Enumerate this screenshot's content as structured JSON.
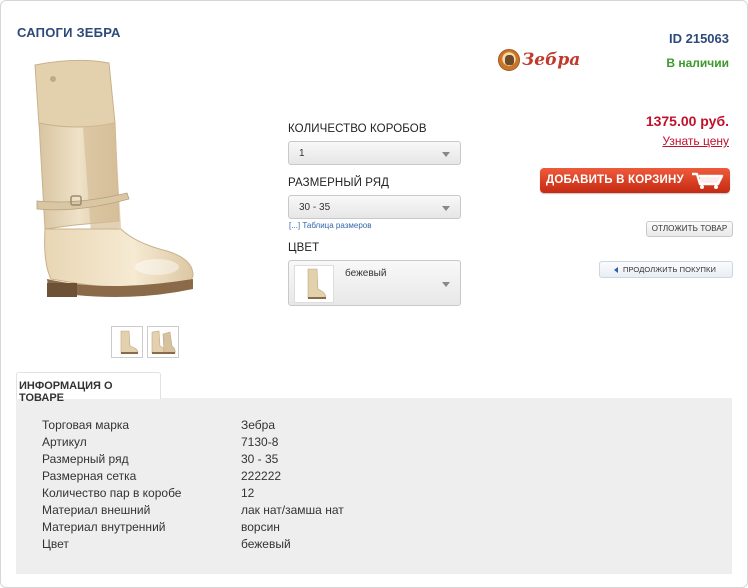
{
  "product": {
    "title": "САПОГИ ЗЕБРА",
    "id_text": "ID 215063",
    "stock_status": "В наличии",
    "brand_logo_text": "Зебра",
    "main_image_icon": "boot-image",
    "thumbnail_icons": [
      "boot-thumbnail-side",
      "boot-thumbnail-pair"
    ]
  },
  "options": {
    "box_count_label": "КОЛИЧЕСТВО КОРОБОВ",
    "box_count_value": "1",
    "size_range_label": "РАЗМЕРНЫЙ РЯД",
    "size_range_value": "30 - 35",
    "size_table_link": "[...] Таблица размеров",
    "color_label": "ЦВЕТ",
    "color_value": "бежевый"
  },
  "purchase": {
    "price": "1375.00 руб.",
    "price_link": "Узнать цену",
    "add_to_cart": "ДОБАВИТЬ В КОРЗИНУ",
    "defer": "ОТЛОЖИТЬ ТОВАР",
    "continue": "ПРОДОЛЖИТЬ ПОКУПКИ"
  },
  "info": {
    "tab_label": "ИНФОРМАЦИЯ О ТОВАРЕ",
    "rows": [
      {
        "label": "Торговая марка",
        "value": "Зебра"
      },
      {
        "label": "Артикул",
        "value": "7130-8"
      },
      {
        "label": "Размерный ряд",
        "value": "30 - 35"
      },
      {
        "label": "Размерная сетка",
        "value": "222222"
      },
      {
        "label": "Количество пар в коробе",
        "value": "12"
      },
      {
        "label": "Материал внешний",
        "value": "лак нат/замша нат"
      },
      {
        "label": "Материал внутренний",
        "value": "ворсин"
      },
      {
        "label": "Цвет",
        "value": "бежевый"
      }
    ]
  },
  "colors": {
    "title": "#2d4a7a",
    "in_stock": "#3a9a2a",
    "price": "#c0102c",
    "cart_button": "#d9391d",
    "boot": "#e9d8bb"
  }
}
